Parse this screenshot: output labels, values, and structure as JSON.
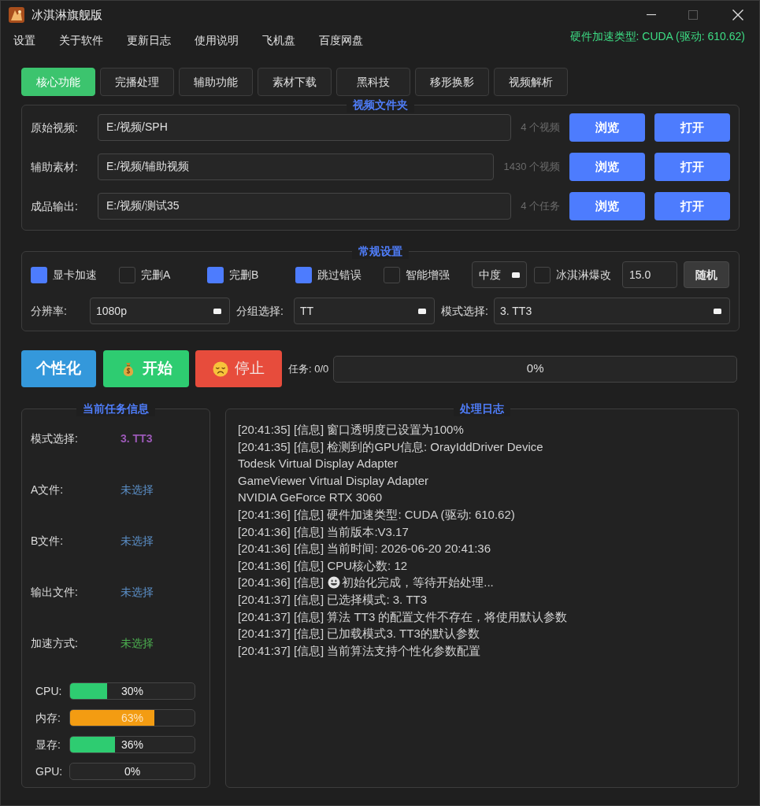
{
  "window": {
    "title": "冰淇淋旗舰版"
  },
  "menu": {
    "items": [
      "设置",
      "关于软件",
      "更新日志",
      "使用说明",
      "飞机盘",
      "百度网盘"
    ],
    "hw_status": "硬件加速类型: CUDA (驱动: 610.62)"
  },
  "tabs": [
    {
      "label": "核心功能",
      "selected": true
    },
    {
      "label": "完播处理",
      "selected": false
    },
    {
      "label": "辅助功能",
      "selected": false
    },
    {
      "label": "素材下载",
      "selected": false
    },
    {
      "label": "黑科技",
      "selected": false
    },
    {
      "label": "移形换影",
      "selected": false
    },
    {
      "label": "视频解析",
      "selected": false
    }
  ],
  "video_folders": {
    "title": "视频文件夹",
    "rows": [
      {
        "label": "原始视频:",
        "path": "E:/视频/SPH",
        "count": "4 个视频",
        "browse": "浏览",
        "open": "打开"
      },
      {
        "label": "辅助素材:",
        "path": "E:/视频/辅助视频",
        "count": "1430 个视频",
        "browse": "浏览",
        "open": "打开"
      },
      {
        "label": "成品输出:",
        "path": "E:/视频/测试35",
        "count": "4 个任务",
        "browse": "浏览",
        "open": "打开"
      }
    ]
  },
  "general_settings": {
    "title": "常规设置",
    "options": [
      {
        "kind": "checkbox",
        "label": "显卡加速",
        "checked": true
      },
      {
        "kind": "checkbox",
        "label": "完删A",
        "checked": false
      },
      {
        "kind": "checkbox",
        "label": "完删B",
        "checked": true
      },
      {
        "kind": "checkbox",
        "label": "跳过错误",
        "checked": true
      },
      {
        "kind": "checkbox",
        "label": "智能增强",
        "checked": false
      },
      {
        "kind": "dropdown",
        "value": "中度"
      },
      {
        "kind": "checkbox",
        "label": "冰淇淋爆改",
        "checked": false
      },
      {
        "kind": "input",
        "value": "15.0"
      },
      {
        "kind": "button",
        "label": "随机"
      }
    ],
    "selects": [
      {
        "label": "分辨率:",
        "value": "1080p"
      },
      {
        "label": "分组选择:",
        "value": "TT"
      },
      {
        "label": "模式选择:",
        "value": "3. TT3"
      }
    ]
  },
  "actions": {
    "buttons": [
      {
        "kind": "personalize",
        "label": "个性化",
        "disabled": false
      },
      {
        "kind": "start",
        "label": "开始",
        "disabled": false
      },
      {
        "kind": "stop",
        "label": "停止",
        "disabled": true
      }
    ],
    "task_count": "任务: 0/0",
    "progress": {
      "level": 0,
      "reading": "0%"
    }
  },
  "task_info": {
    "title": "当前任务信息",
    "rows": [
      {
        "label": "模式选择:",
        "value": "3. TT3",
        "color": "#9b59b6",
        "bold": true
      },
      {
        "label": "A文件:",
        "value": "未选择",
        "color": "#5b8fc7",
        "bold": false
      },
      {
        "label": "B文件:",
        "value": "未选择",
        "color": "#5b8fc7",
        "bold": false
      },
      {
        "label": "输出文件:",
        "value": "未选择",
        "color": "#5b8fc7",
        "bold": false
      },
      {
        "label": "加速方式:",
        "value": "未选择",
        "color": "#4caf50",
        "bold": false
      }
    ],
    "resources": [
      {
        "label": "CPU:",
        "level": 0.3,
        "reading": "30%",
        "warning": false
      },
      {
        "label": "内存:",
        "level": 0.68,
        "reading": "63%",
        "warning": true
      },
      {
        "label": "显存:",
        "level": 0.36,
        "reading": "36%",
        "warning": false
      },
      {
        "label": "GPU:",
        "level": 0,
        "reading": "0%",
        "warning": false
      }
    ]
  },
  "log": {
    "title": "处理日志",
    "lines": [
      {
        "kind": "plain",
        "text": "[20:41:35] [信息] 窗口透明度已设置为100%"
      },
      {
        "kind": "plain",
        "text": "[20:41:35] [信息] 检测到的GPU信息: OrayIddDriver Device"
      },
      {
        "kind": "plain",
        "text": "Todesk Virtual Display Adapter"
      },
      {
        "kind": "plain",
        "text": "GameViewer Virtual Display Adapter"
      },
      {
        "kind": "plain",
        "text": "NVIDIA GeForce RTX 3060"
      },
      {
        "kind": "plain",
        "text": "[20:41:36] [信息] 硬件加速类型: CUDA (驱动: 610.62)"
      },
      {
        "kind": "plain",
        "text": "[20:41:36] [信息] 当前版本:V3.17"
      },
      {
        "kind": "plain",
        "text": "[20:41:36] [信息] 当前时间: 2026-06-20 20:41:36"
      },
      {
        "kind": "plain",
        "text": "[20:41:36] [信息] CPU核心数: 12"
      },
      {
        "kind": "emoji",
        "prefix": "[20:41:36] [信息]",
        "text": "初始化完成，等待开始处理..."
      },
      {
        "kind": "plain",
        "text": "[20:41:37] [信息] 已选择模式: 3. TT3"
      },
      {
        "kind": "plain",
        "text": "[20:41:37] [信息] 算法 TT3 的配置文件不存在，将使用默认参数"
      },
      {
        "kind": "plain",
        "text": "[20:41:37] [信息] 已加载模式3. TT3的默认参数"
      },
      {
        "kind": "plain",
        "text": "[20:41:37] [信息] 当前算法支持个性化参数配置"
      }
    ]
  }
}
